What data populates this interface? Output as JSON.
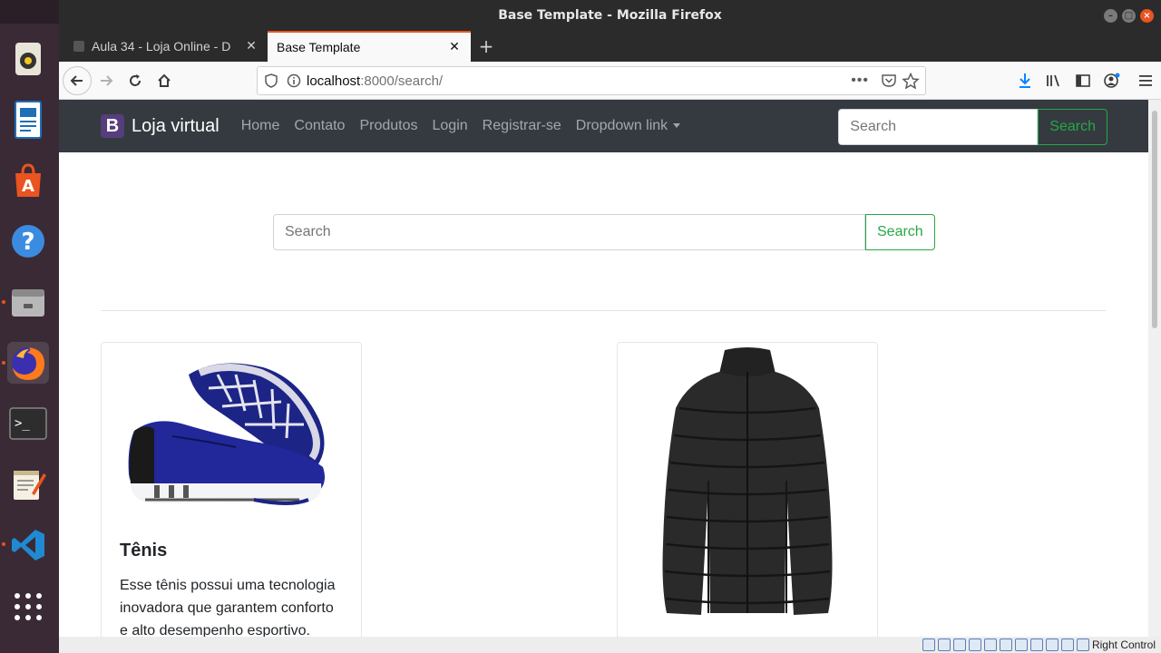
{
  "window": {
    "title": "Base Template - Mozilla Firefox"
  },
  "tabs": [
    {
      "label": "Aula 34 - Loja Online - D",
      "active": false
    },
    {
      "label": "Base Template",
      "active": true
    }
  ],
  "urlbar": {
    "host": "localhost",
    "path": ":8000/search/"
  },
  "site": {
    "brand_letter": "B",
    "brand_name": "Loja virtual",
    "nav": [
      "Home",
      "Contato",
      "Produtos",
      "Login",
      "Registrar-se",
      "Dropdown link"
    ],
    "nav_search_placeholder": "Search",
    "nav_search_button": "Search"
  },
  "main_search": {
    "placeholder": "Search",
    "button": "Search"
  },
  "products": [
    {
      "title": "Tênis",
      "description": "Esse tênis possui uma tecnologia inovadora que garantem conforto e alto desempenho esportivo."
    },
    {
      "title": "",
      "description": ""
    }
  ],
  "statusbar": {
    "label": "Right Control"
  },
  "colors": {
    "accent": "#e95420",
    "navbar": "#343a40",
    "success": "#28a745",
    "brand": "#563d7c"
  }
}
